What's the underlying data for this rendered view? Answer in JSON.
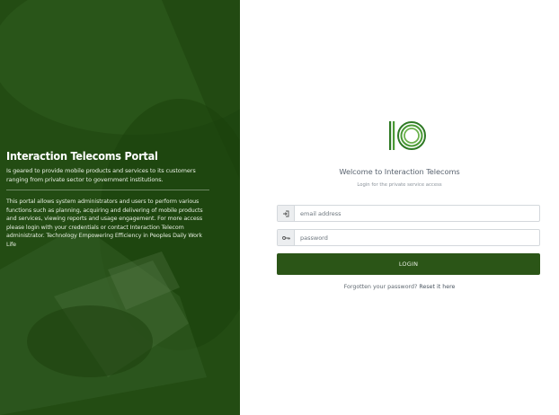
{
  "left_panel": {
    "title": "Interaction Telecoms Portal",
    "subtitle": "Is geared to provide mobile products and services to its customers ranging from private sector to government institutions.",
    "description": "This portal allows system administrators and users to perform various functions such as planning, acquiring and delivering of mobile products and services, viewing reports and usage engagement. For more access please login with your credentials or contact Interaction Telecom administrator. Technology Empowering Efficiency in Peoples Daily Work Life"
  },
  "login": {
    "welcome": "Welcome to Interaction Telecoms",
    "tagline": "Login for the private service access",
    "email_placeholder": "email address",
    "password_placeholder": "password",
    "login_label": "LOGIN",
    "forgot_text": "Forgotten your password?",
    "reset_link": "Reset it here"
  },
  "colors": {
    "brand_green": "#2b5517",
    "logo_green": "#3c8a2e"
  },
  "icons": {
    "email": "login-arrow-icon",
    "password": "key-icon",
    "logo": "interaction-telecoms-logo"
  }
}
